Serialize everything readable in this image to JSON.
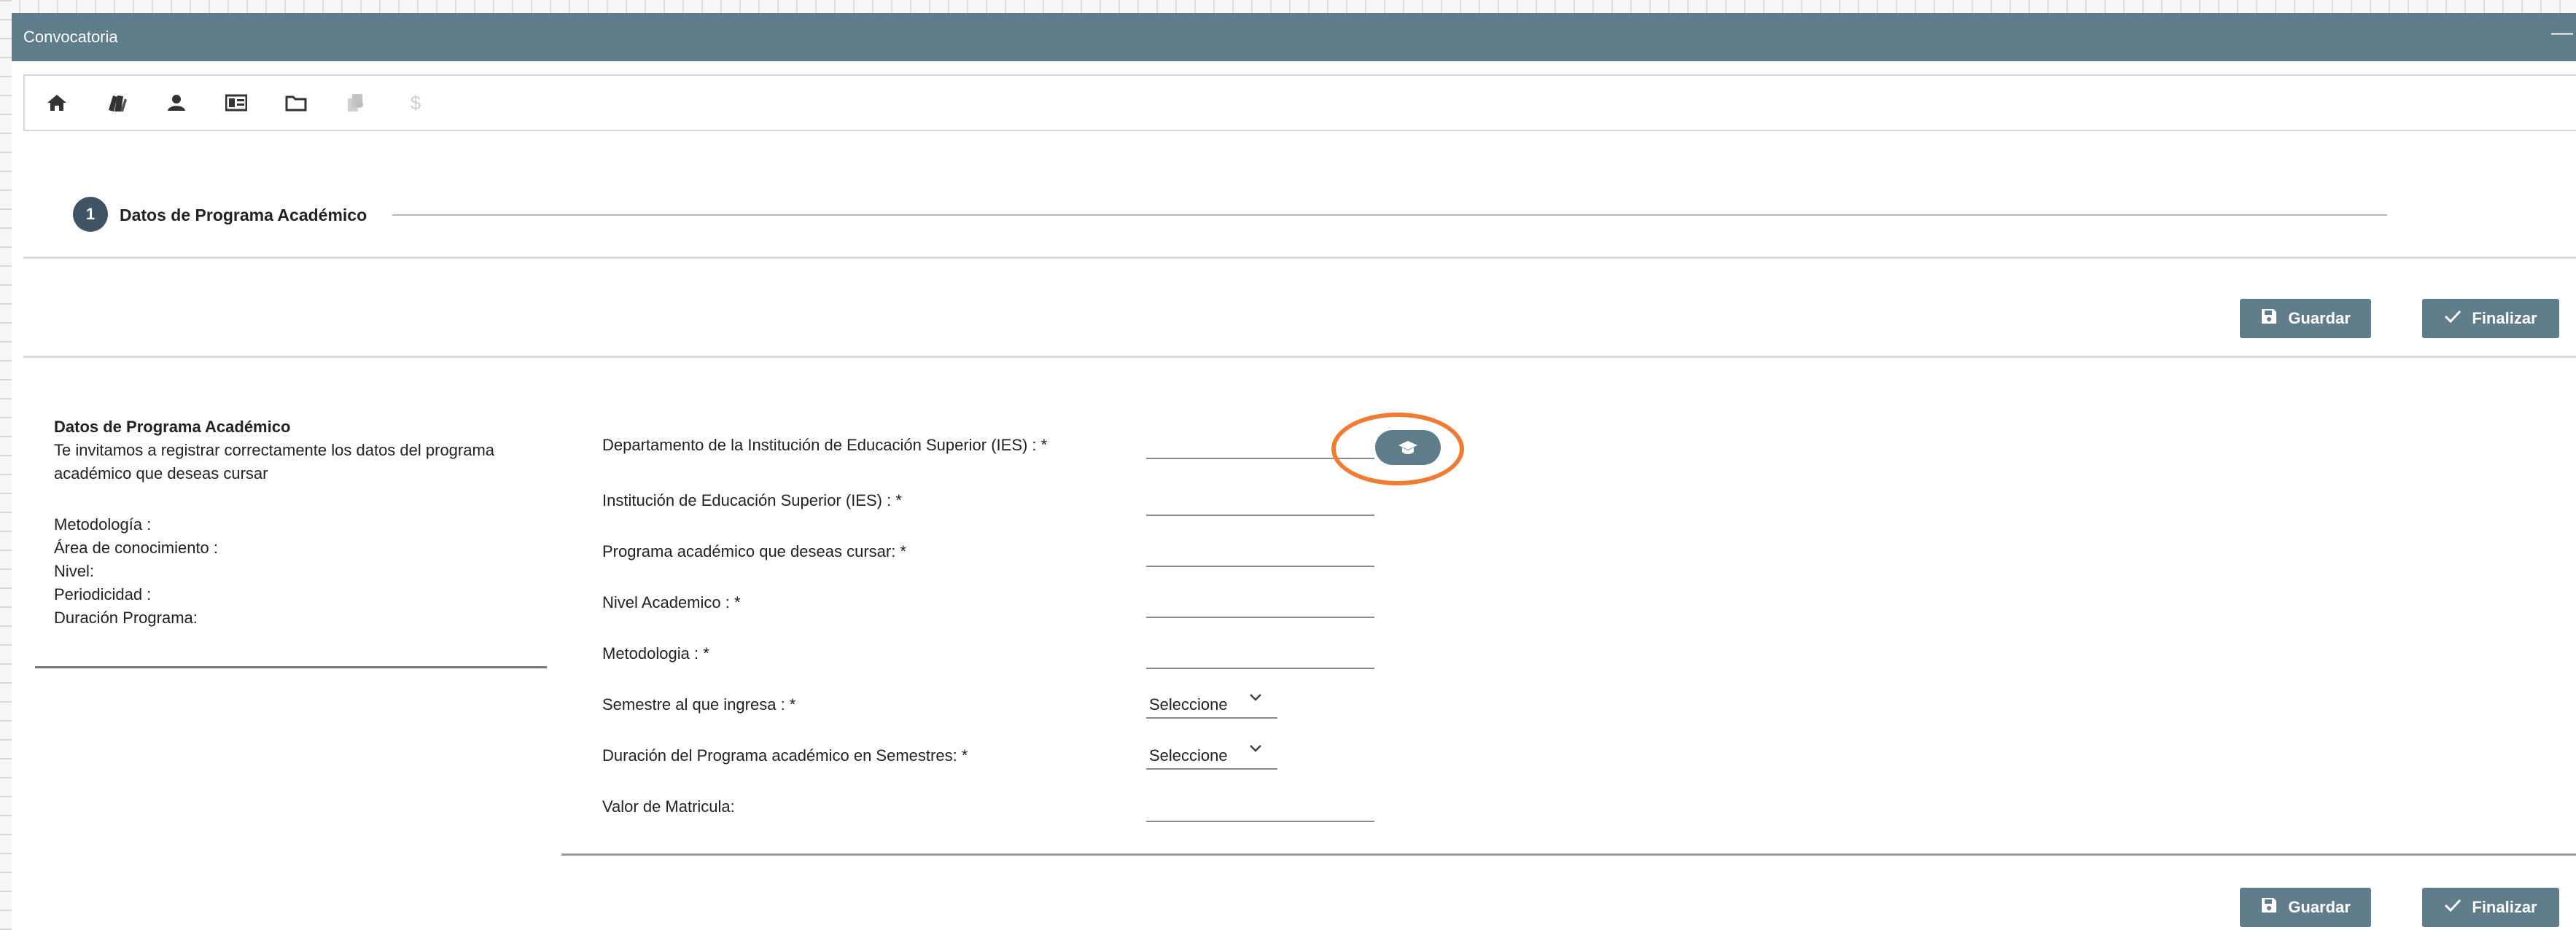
{
  "window": {
    "title": "Convocatoria",
    "minimize_symbol": "—"
  },
  "toolbar": {
    "icons": [
      "home-icon",
      "books-icon",
      "person-icon",
      "id-card-icon",
      "folder-icon",
      "documents-icon",
      "dollar-icon"
    ],
    "dollar_glyph": "$"
  },
  "stepper": {
    "number": "1",
    "label": "Datos de Programa Académico"
  },
  "buttons": {
    "save_label": "Guardar",
    "finish_label": "Finalizar"
  },
  "info_panel": {
    "heading": "Datos de Programa Académico",
    "description": "Te invitamos a registrar correctamente los datos del programa académico que deseas cursar",
    "metodologia": "Metodología :",
    "area": "Área de conocimiento :",
    "nivel": "Nivel:",
    "periodicidad": "Periodicidad :",
    "duracion": "Duración Programa:"
  },
  "form": {
    "departamento_label": "Departamento de la Institución de Educación Superior (IES) : *",
    "ies_label": "Institución de Educación Superior (IES) : *",
    "programa_label": "Programa académico que deseas cursar: *",
    "nivel_label": "Nivel Academico : *",
    "metodologia_label": "Metodologia : *",
    "semestre_label": "Semestre al que ingresa : *",
    "semestre_value": "Seleccione",
    "duracion_label": "Duración del Programa académico en Semestres: *",
    "duracion_value": "Seleccione",
    "valor_label": "Valor de Matricula:"
  },
  "colors": {
    "titlebar": "#607d8b",
    "button": "#607d8b",
    "highlight": "#f07c33",
    "step_circle": "#3f5566"
  }
}
